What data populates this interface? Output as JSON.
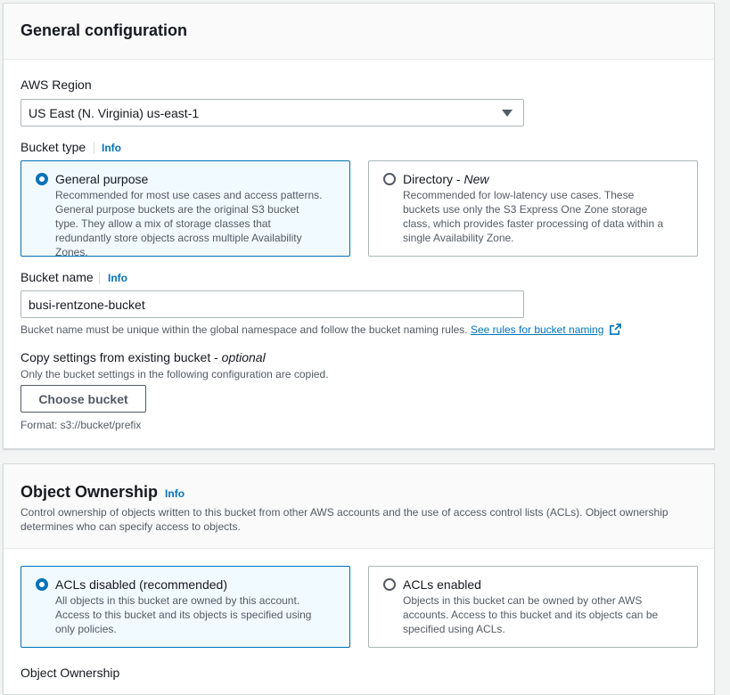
{
  "general": {
    "title": "General configuration",
    "region_label": "AWS Region",
    "region_value": "US East (N. Virginia) us-east-1",
    "bucket_type_label": "Bucket type",
    "info": "Info",
    "general_purpose": {
      "title": "General purpose",
      "desc": "Recommended for most use cases and access patterns. General purpose buckets are the original S3 bucket type. They allow a mix of storage classes that redundantly store objects across multiple Availability Zones."
    },
    "directory": {
      "title": "Directory - ",
      "title_em": "New",
      "desc": "Recommended for low-latency use cases. These buckets use only the S3 Express One Zone storage class, which provides faster processing of data within a single Availability Zone."
    },
    "bucket_name_label": "Bucket name",
    "bucket_name_value": "busi-rentzone-bucket",
    "bucket_name_hint": "Bucket name must be unique within the global namespace and follow the bucket naming rules. ",
    "bucket_name_link": "See rules for bucket naming",
    "copy_label": "Copy settings from existing bucket - ",
    "copy_label_em": "optional",
    "copy_desc": "Only the bucket settings in the following configuration are copied.",
    "choose_bucket": "Choose bucket",
    "format_hint": "Format: s3://bucket/prefix"
  },
  "ownership": {
    "title": "Object Ownership",
    "info": "Info",
    "desc": "Control ownership of objects written to this bucket from other AWS accounts and the use of access control lists (ACLs). Object ownership determines who can specify access to objects.",
    "acls_disabled": {
      "title": "ACLs disabled (recommended)",
      "desc": "All objects in this bucket are owned by this account. Access to this bucket and its objects is specified using only policies."
    },
    "acls_enabled": {
      "title": "ACLs enabled",
      "desc": "Objects in this bucket can be owned by other AWS accounts. Access to this bucket and its objects can be specified using ACLs."
    },
    "sub_label": "Object Ownership"
  },
  "icons": {
    "dropdown": "caret-down-icon",
    "external": "external-link-icon"
  },
  "colors": {
    "accent": "#0073bb",
    "selected_bg": "#f1faff",
    "header_bg": "#fafafa"
  }
}
